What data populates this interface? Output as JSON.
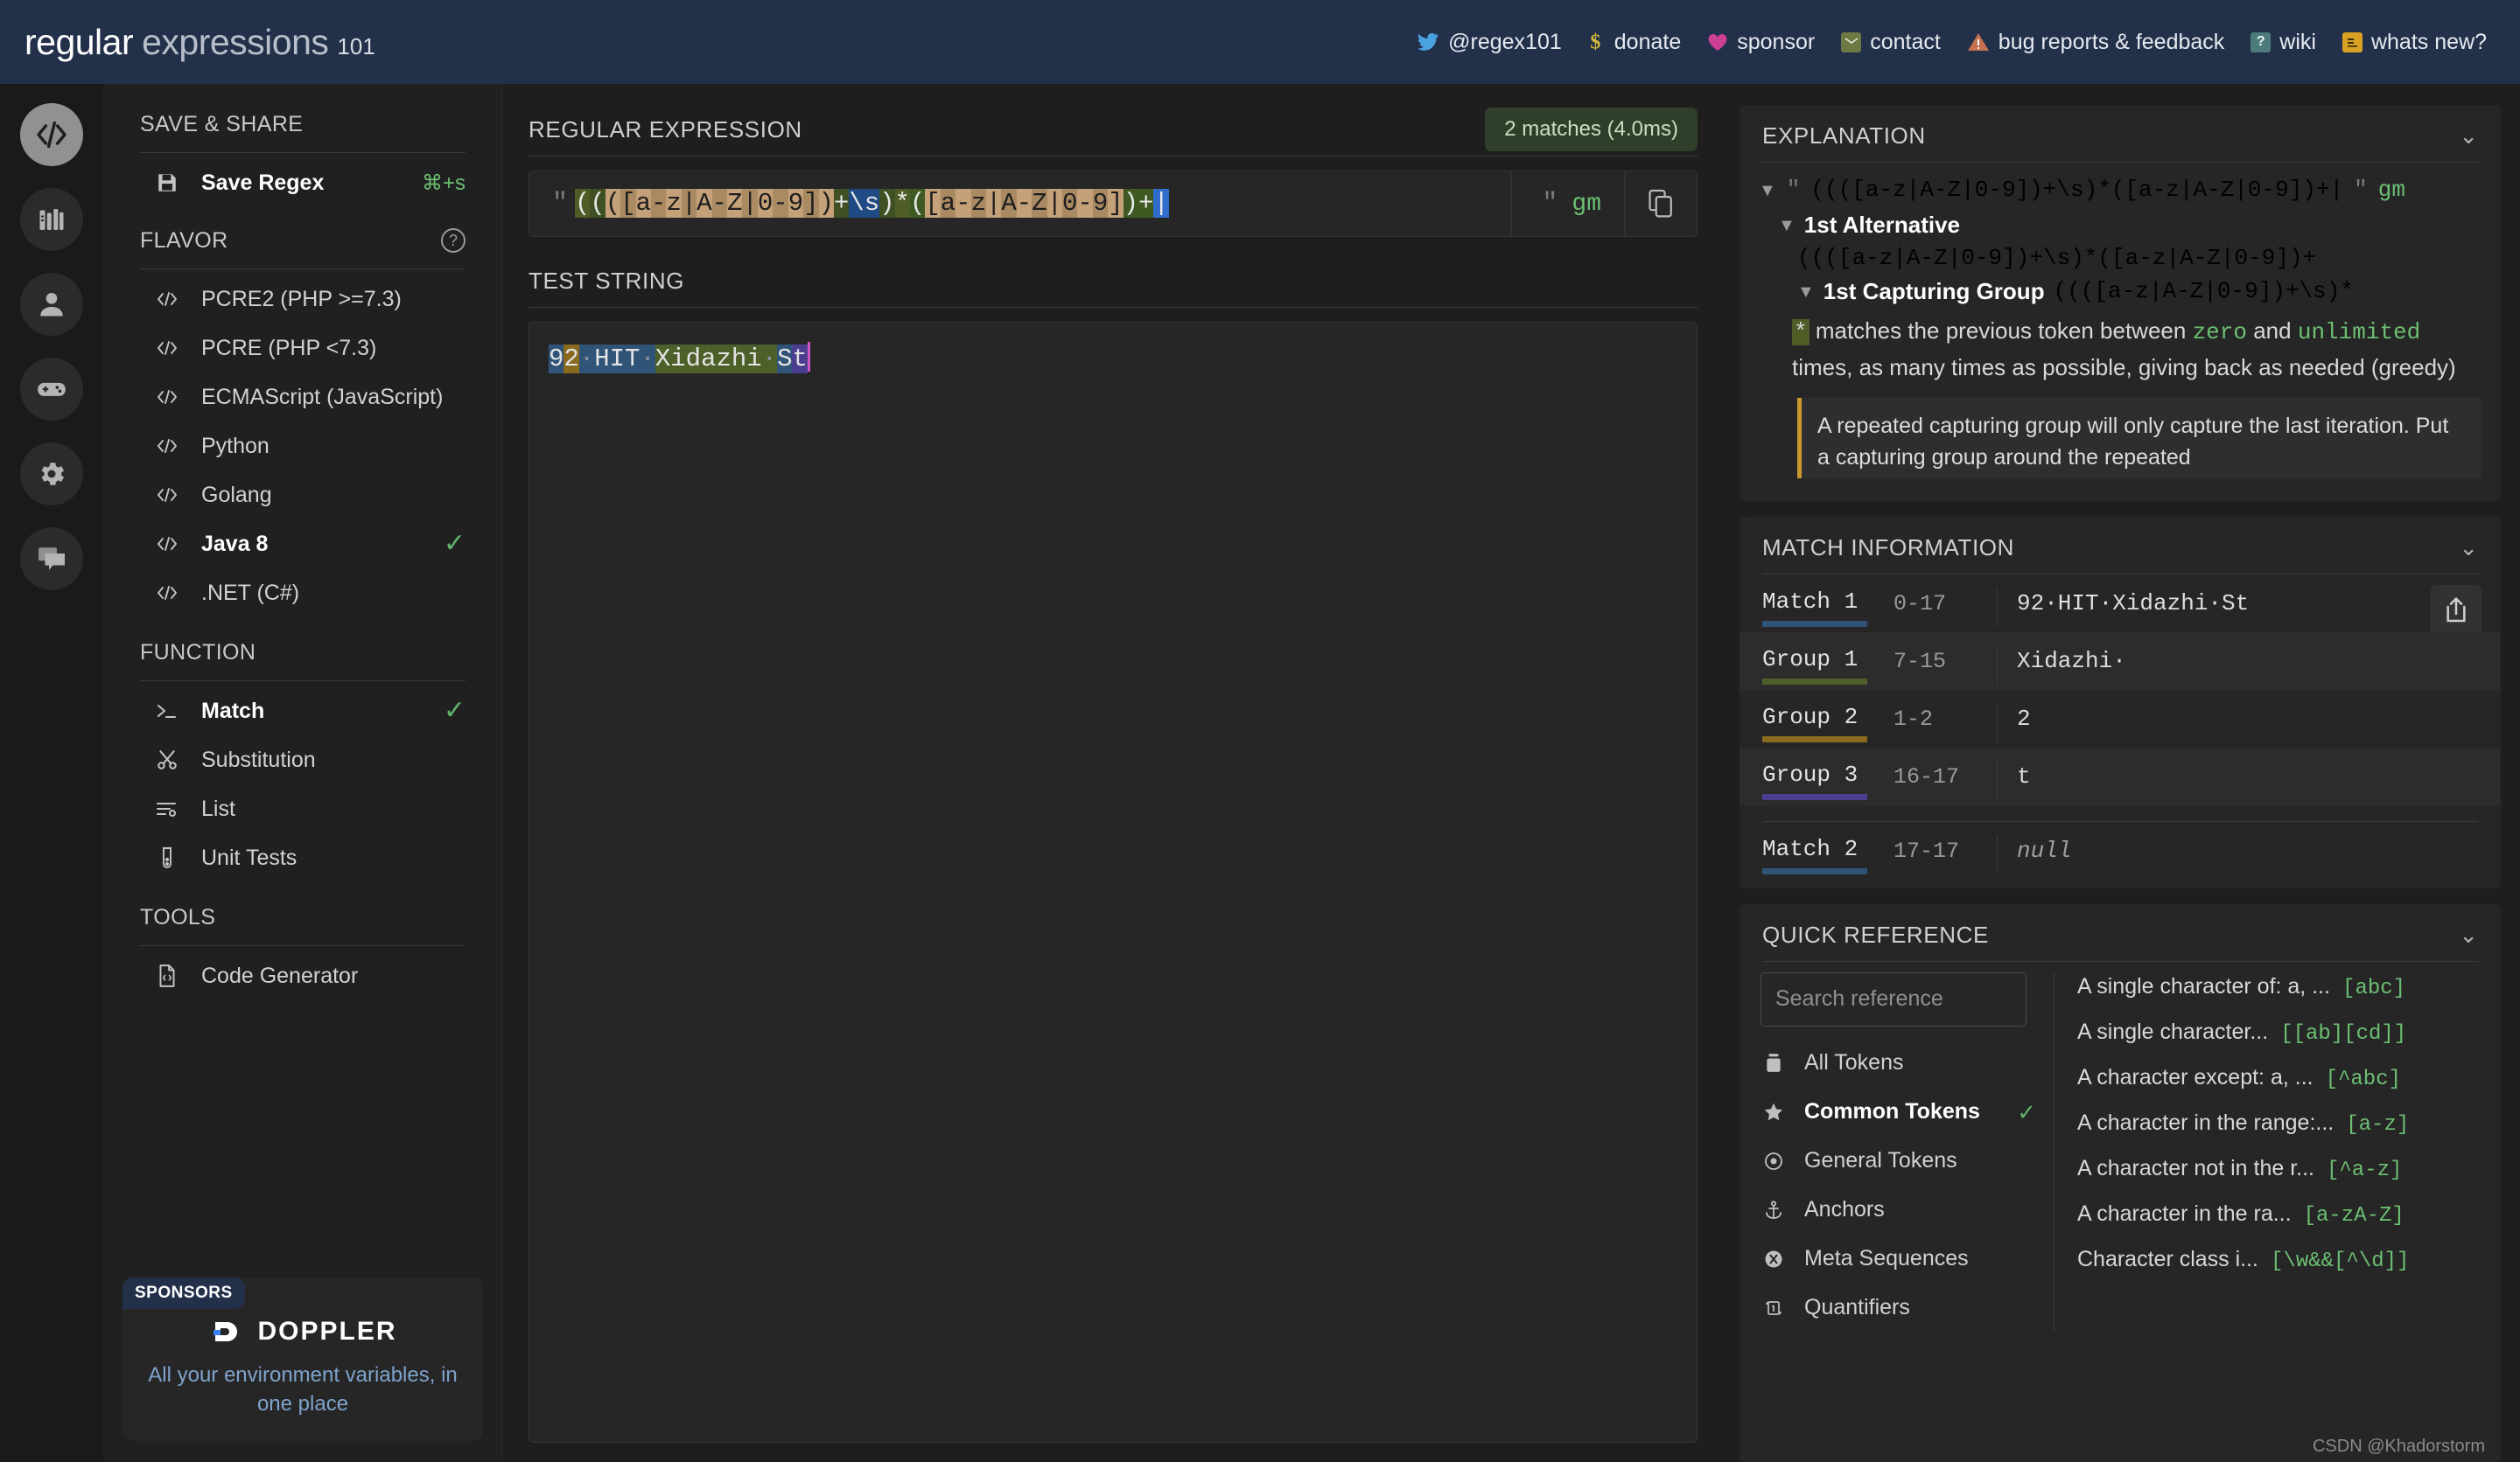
{
  "header": {
    "brand_part1": "regular",
    "brand_part2": "expressions",
    "brand_suffix": "101",
    "links": [
      {
        "label": "@regex101",
        "icon": "twitter-icon"
      },
      {
        "label": "donate",
        "icon": "dollar-icon"
      },
      {
        "label": "sponsor",
        "icon": "heart-icon"
      },
      {
        "label": "contact",
        "icon": "envelope-icon"
      },
      {
        "label": "bug reports & feedback",
        "icon": "warning-triangle-icon"
      },
      {
        "label": "wiki",
        "icon": "question-box-icon"
      },
      {
        "label": "whats new?",
        "icon": "news-icon"
      }
    ]
  },
  "rail": [
    {
      "name": "code-icon",
      "active": true
    },
    {
      "name": "library-icon",
      "active": false
    },
    {
      "name": "account-icon",
      "active": false
    },
    {
      "name": "gamepad-icon",
      "active": false
    },
    {
      "name": "settings-gear-icon",
      "active": false
    },
    {
      "name": "community-chat-icon",
      "active": false
    }
  ],
  "sidebar": {
    "save_share": {
      "title": "SAVE & SHARE",
      "items": [
        {
          "label": "Save Regex",
          "shortcut": "⌘+s",
          "icon": "floppy-disk-icon"
        }
      ]
    },
    "flavor": {
      "title": "FLAVOR",
      "help_icon": "help-circle-icon",
      "items": [
        {
          "label": "PCRE2 (PHP >=7.3)",
          "selected": false
        },
        {
          "label": "PCRE (PHP <7.3)",
          "selected": false
        },
        {
          "label": "ECMAScript (JavaScript)",
          "selected": false
        },
        {
          "label": "Python",
          "selected": false
        },
        {
          "label": "Golang",
          "selected": false
        },
        {
          "label": "Java 8",
          "selected": true
        },
        {
          "label": ".NET (C#)",
          "selected": false
        }
      ]
    },
    "function": {
      "title": "FUNCTION",
      "items": [
        {
          "label": "Match",
          "selected": true,
          "icon": "terminal-icon"
        },
        {
          "label": "Substitution",
          "selected": false,
          "icon": "scissors-icon"
        },
        {
          "label": "List",
          "selected": false,
          "icon": "list-settings-icon"
        },
        {
          "label": "Unit Tests",
          "selected": false,
          "icon": "test-tube-icon"
        }
      ]
    },
    "tools": {
      "title": "TOOLS",
      "items": [
        {
          "label": "Code Generator",
          "selected": false,
          "icon": "code-file-icon"
        }
      ]
    },
    "sponsor": {
      "tag": "SPONSORS",
      "name": "DOPPLER",
      "tagline": "All your environment variables, in one place"
    }
  },
  "main": {
    "regex_title": "REGULAR EXPRESSION",
    "matches_badge": "2 matches (4.0ms)",
    "delimiter": "\"",
    "flags": "gm",
    "copy_icon": "copy-icon",
    "regex_pattern": "((([a-z|A-Z|0-9])+\\s)*([a-z|A-Z|0-9])+|",
    "test_title": "TEST STRING",
    "test_string": "92 HIT Xidazhi St"
  },
  "explanation": {
    "title": "EXPLANATION",
    "collapse_icon": "chevron-down-icon",
    "pattern_flags": "gm",
    "alternative_label": "1st Alternative",
    "group_label": "1st Capturing Group",
    "detail_prefix": "matches the previous token between",
    "detail_kw1": "zero",
    "detail_mid": "and",
    "detail_kw2": "unlimited",
    "detail_suffix": "times, as many times as possible, giving back as needed (greedy)",
    "note": "A repeated capturing group will only capture the last iteration. Put a capturing group around the repeated"
  },
  "match_information": {
    "title": "MATCH INFORMATION",
    "collapse_icon": "chevron-down-icon",
    "share_icon": "share-upload-icon",
    "rows": [
      {
        "name": "Match 1",
        "range": "0-17",
        "value": "92·HIT·Xidazhi·St",
        "color": "#2f5478",
        "alt": false,
        "null": false
      },
      {
        "name": "Group 1",
        "range": "7-15",
        "value": "Xidazhi·",
        "color": "#4d6029",
        "alt": true,
        "null": false
      },
      {
        "name": "Group 2",
        "range": "1-2",
        "value": "2",
        "color": "#8a6a1f",
        "alt": false,
        "null": false
      },
      {
        "name": "Group 3",
        "range": "16-17",
        "value": "t",
        "color": "#4b3d8f",
        "alt": true,
        "null": false
      },
      {
        "name": "Match 2",
        "range": "17-17",
        "value": "null",
        "color": "#2f5478",
        "alt": false,
        "null": true
      }
    ]
  },
  "quick_reference": {
    "title": "QUICK REFERENCE",
    "collapse_icon": "chevron-down-icon",
    "search_placeholder": "Search reference",
    "categories": [
      {
        "label": "All Tokens",
        "selected": false,
        "icon": "tokens-icon"
      },
      {
        "label": "Common Tokens",
        "selected": true,
        "icon": "star-icon"
      },
      {
        "label": "General Tokens",
        "selected": false,
        "icon": "target-icon"
      },
      {
        "label": "Anchors",
        "selected": false,
        "icon": "anchor-icon"
      },
      {
        "label": "Meta Sequences",
        "selected": false,
        "icon": "meta-icon"
      },
      {
        "label": "Quantifiers",
        "selected": false,
        "icon": "quantifier-icon"
      }
    ],
    "references": [
      {
        "desc": "A single character of: a, ...",
        "token": "[abc]"
      },
      {
        "desc": "A single character...",
        "token": "[[ab][cd]]"
      },
      {
        "desc": "A character except: a, ...",
        "token": "[^abc]"
      },
      {
        "desc": "A character in the range:...",
        "token": "[a-z]"
      },
      {
        "desc": "A character not in the r...",
        "token": "[^a-z]"
      },
      {
        "desc": "A character in the ra...",
        "token": "[a-zA-Z]"
      },
      {
        "desc": "Character class i...",
        "token": "[\\w&&[^\\d]]"
      }
    ]
  },
  "watermark": "CSDN @Khadorstorm"
}
